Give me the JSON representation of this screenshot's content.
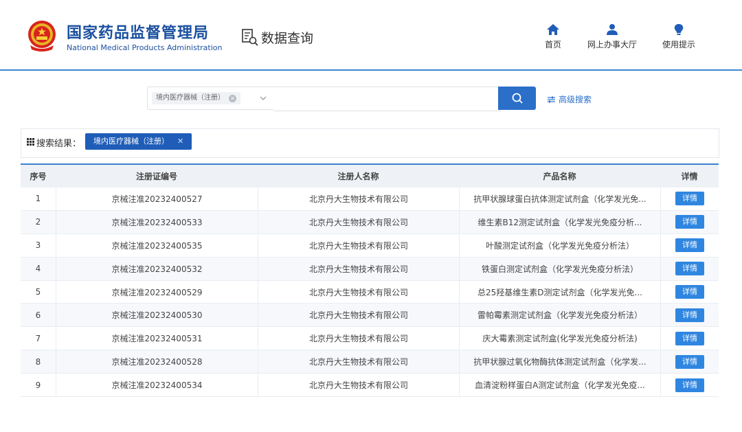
{
  "header": {
    "title_cn": "国家药品监督管理局",
    "title_en": "National Medical Products Administration",
    "query_label": "数据查询",
    "nav": [
      {
        "label": "首页",
        "icon": "home-icon"
      },
      {
        "label": "网上办事大厅",
        "icon": "user-icon"
      },
      {
        "label": "使用提示",
        "icon": "lightbulb-icon"
      }
    ]
  },
  "search": {
    "category_tag": "境内医疗器械（注册）",
    "query_value": "",
    "advanced_label": "高级搜索"
  },
  "results": {
    "label": "搜索结果：",
    "active_filter": "境内医疗器械（注册）"
  },
  "table": {
    "columns": [
      "序号",
      "注册证编号",
      "注册人名称",
      "产品名称",
      "详情"
    ],
    "detail_label": "详情",
    "rows": [
      {
        "index": "1",
        "cert": "京械注准20232400527",
        "registrant": "北京丹大生物技术有限公司",
        "product": "抗甲状腺球蛋白抗体测定试剂盒（化学发光免..."
      },
      {
        "index": "2",
        "cert": "京械注准20232400533",
        "registrant": "北京丹大生物技术有限公司",
        "product": "维生素B12测定试剂盒（化学发光免疫分析..."
      },
      {
        "index": "3",
        "cert": "京械注准20232400535",
        "registrant": "北京丹大生物技术有限公司",
        "product": "叶酸测定试剂盒（化学发光免疫分析法）"
      },
      {
        "index": "4",
        "cert": "京械注准20232400532",
        "registrant": "北京丹大生物技术有限公司",
        "product": "铁蛋白测定试剂盒（化学发光免疫分析法）"
      },
      {
        "index": "5",
        "cert": "京械注准20232400529",
        "registrant": "北京丹大生物技术有限公司",
        "product": "总25羟基维生素D测定试剂盒（化学发光免..."
      },
      {
        "index": "6",
        "cert": "京械注准20232400530",
        "registrant": "北京丹大生物技术有限公司",
        "product": "雷帕霉素测定试剂盒（化学发光免疫分析法）"
      },
      {
        "index": "7",
        "cert": "京械注准20232400531",
        "registrant": "北京丹大生物技术有限公司",
        "product": "庆大霉素测定试剂盒(化学发光免疫分析法)"
      },
      {
        "index": "8",
        "cert": "京械注准20232400528",
        "registrant": "北京丹大生物技术有限公司",
        "product": "抗甲状腺过氧化物酶抗体测定试剂盒（化学发..."
      },
      {
        "index": "9",
        "cert": "京械注准20232400534",
        "registrant": "北京丹大生物技术有限公司",
        "product": "血清淀粉样蛋白A测定试剂盒（化学发光免疫..."
      }
    ]
  },
  "colors": {
    "brand": "#1a4f9e",
    "accent": "#2b6fc9",
    "detail_button": "#2f86e0"
  }
}
